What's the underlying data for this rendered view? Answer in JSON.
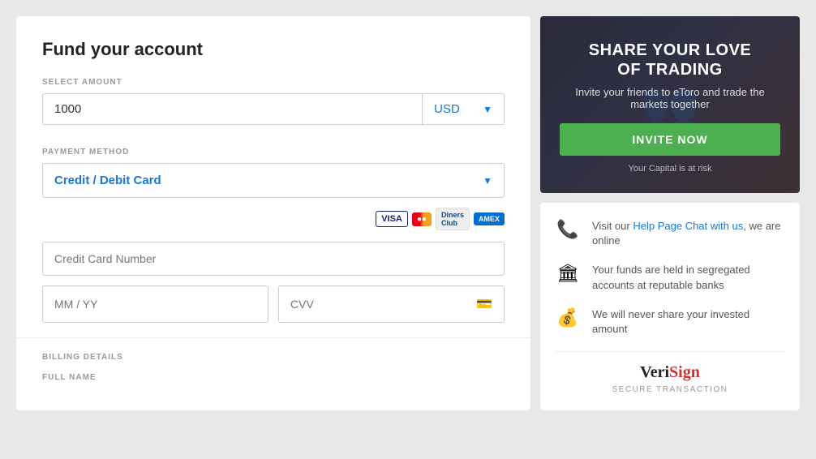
{
  "left": {
    "title": "Fund your account",
    "select_amount_label": "SELECT AMOUNT",
    "amount_value": "1000",
    "currency": "USD",
    "payment_method_label": "PAYMENT METHOD",
    "payment_option": "Credit / Debit Card",
    "cc_number_placeholder": "Credit Card Number",
    "expiry_placeholder": "MM / YY",
    "cvv_placeholder": "CVV",
    "billing_label": "BILLING DETAILS",
    "full_name_label": "FULL NAME"
  },
  "banner": {
    "heading_line1": "SHARE YOUR LOVE",
    "heading_line2": "OF TRADING",
    "subtext": "Invite your friends to eToro and trade the markets together",
    "invite_btn": "INVITE NOW",
    "risk_text": "Your Capital is at risk"
  },
  "info": {
    "items": [
      {
        "icon": "📞",
        "html_before": "Visit our ",
        "link1": "Help Page",
        "html_mid": " ",
        "link2": "Chat with us",
        "html_after": ", we are online"
      },
      {
        "icon": "🏛",
        "text": "Your funds are held in segregated accounts at reputable banks"
      },
      {
        "icon": "💰",
        "text": "We will never share your invested amount"
      }
    ],
    "verisign_label": "VeriSign",
    "secure_label": "SECURE TRANSACTION"
  },
  "cards": [
    {
      "label": "VISA",
      "type": "visa"
    },
    {
      "label": "MC",
      "type": "mc"
    },
    {
      "label": "Diners Club",
      "type": "dc"
    },
    {
      "label": "Amex",
      "type": "amex"
    }
  ]
}
